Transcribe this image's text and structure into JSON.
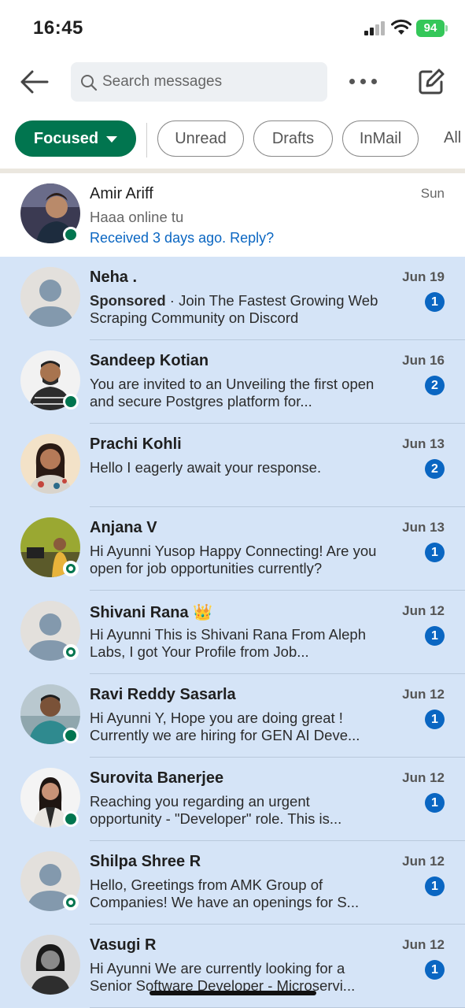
{
  "status_bar": {
    "time": "16:45",
    "battery": "94"
  },
  "search": {
    "placeholder": "Search messages"
  },
  "filters": {
    "focused": "Focused",
    "unread": "Unread",
    "drafts": "Drafts",
    "inmail": "InMail",
    "all": "All"
  },
  "conversations": [
    {
      "name": "Amir Ariff",
      "date": "Sun",
      "preview": "Haaa online tu",
      "reply_hint": "Received 3 days ago. Reply?",
      "unread": false,
      "online": "solid"
    },
    {
      "name": "Neha .",
      "date": "Jun 19",
      "sponsored_label": "Sponsored",
      "preview": " · Join The Fastest Growing Web Scraping Community on Discord",
      "badge": "1",
      "unread": true,
      "online": "none"
    },
    {
      "name": "Sandeep Kotian",
      "date": "Jun 16",
      "preview": "You are invited to an Unveiling the first open and secure Postgres platform for...",
      "badge": "2",
      "unread": true,
      "online": "solid"
    },
    {
      "name": "Prachi Kohli",
      "date": "Jun 13",
      "preview": "Hello  I eagerly await your response.",
      "badge": "2",
      "unread": true,
      "online": "none"
    },
    {
      "name": "Anjana V",
      "date": "Jun 13",
      "preview": "Hi Ayunni Yusop Happy Connecting! Are you open for job opportunities currently?",
      "badge": "1",
      "unread": true,
      "online": "ring"
    },
    {
      "name": "Shivani Rana 👑",
      "date": "Jun 12",
      "preview": "Hi Ayunni This is Shivani Rana From Aleph Labs, I got Your Profile from Job...",
      "badge": "1",
      "unread": true,
      "online": "ring"
    },
    {
      "name": "Ravi Reddy Sasarla",
      "date": "Jun 12",
      "preview": "Hi Ayunni Y, Hope you are doing great ! Currently we are hiring for GEN AI Deve...",
      "badge": "1",
      "unread": true,
      "online": "solid"
    },
    {
      "name": "Surovita Banerjee",
      "date": "Jun 12",
      "preview": "Reaching you regarding an urgent opportunity - \"Developer\" role. This is...",
      "badge": "1",
      "unread": true,
      "online": "solid"
    },
    {
      "name": "Shilpa Shree R",
      "date": "Jun 12",
      "preview": "Hello, Greetings from AMK Group of Companies! We have an openings for S...",
      "badge": "1",
      "unread": true,
      "online": "ring"
    },
    {
      "name": "Vasugi R",
      "date": "Jun 12",
      "preview": "Hi Ayunni  We are currently looking for a Senior Software Developer - Microservi...",
      "badge": "1",
      "unread": true,
      "online": "none"
    }
  ],
  "colors": {
    "accent_green": "#01754f",
    "link_blue": "#0a66c2",
    "unread_bg": "#d5e4f7"
  }
}
